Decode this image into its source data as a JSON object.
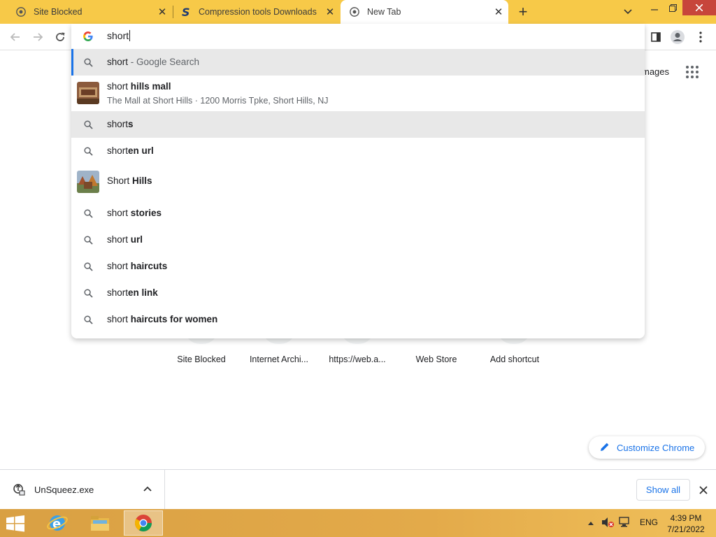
{
  "tabs": [
    {
      "title": "Site Blocked",
      "favicon": "chrome-icon",
      "active": false
    },
    {
      "title": "Compression tools Downloads",
      "favicon": "s-logo-icon",
      "active": false
    },
    {
      "title": "New Tab",
      "favicon": "chrome-icon",
      "active": true
    }
  ],
  "omnibox": {
    "value": "short",
    "suggestions": [
      {
        "icon": "search-icon",
        "prefix": "short",
        "bold": "",
        "suffix": " - Google Search",
        "selected": true
      },
      {
        "icon": "place-thumbnail",
        "prefix": "short ",
        "bold": "hills mall",
        "subtitle": "The Mall at Short Hills · 1200 Morris Tpke, Short Hills, NJ"
      },
      {
        "icon": "search-icon",
        "prefix": "short",
        "bold": "s",
        "hover": true
      },
      {
        "icon": "search-icon",
        "prefix": "short",
        "bold": "en url"
      },
      {
        "icon": "place-thumbnail",
        "prefix": "Short ",
        "bold": "Hills"
      },
      {
        "icon": "search-icon",
        "prefix": "short ",
        "bold": "stories"
      },
      {
        "icon": "search-icon",
        "prefix": "short ",
        "bold": "url"
      },
      {
        "icon": "search-icon",
        "prefix": "short ",
        "bold": "haircuts"
      },
      {
        "icon": "search-icon",
        "prefix": "short",
        "bold": "en link"
      },
      {
        "icon": "search-icon",
        "prefix": "short ",
        "bold": "haircuts for women"
      }
    ]
  },
  "ntp": {
    "images_link": "mages",
    "shortcuts": [
      "Site Blocked",
      "Internet Archi...",
      "https://web.a...",
      "Web Store",
      "Add shortcut"
    ],
    "customize_label": "Customize Chrome"
  },
  "download": {
    "filename": "UnSqueez.exe",
    "show_all": "Show all"
  },
  "taskbar": {
    "lang": "ENG",
    "time": "4:39 PM",
    "date": "7/21/2022"
  },
  "colors": {
    "tabstrip": "#f7c948",
    "accent": "#1a73e8",
    "close_red": "#c7453b"
  }
}
